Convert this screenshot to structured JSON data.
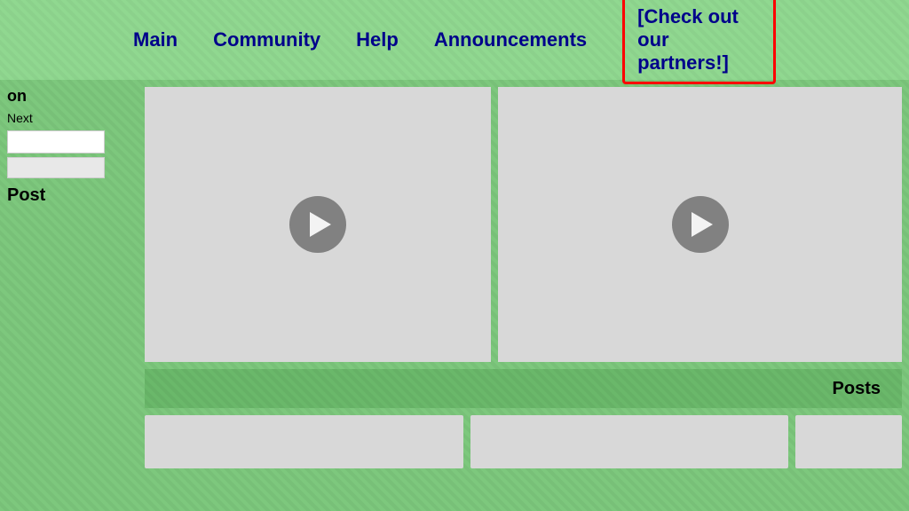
{
  "navbar": {
    "items": [
      {
        "id": "main",
        "label": "Main"
      },
      {
        "id": "community",
        "label": "Community"
      },
      {
        "id": "help",
        "label": "Help"
      },
      {
        "id": "announcements",
        "label": "Announcements"
      }
    ],
    "partners_label": "[Check out our partners!]"
  },
  "sidebar": {
    "on_label": "on",
    "next_label": "Next",
    "post_label": "Post"
  },
  "main": {
    "posts_label": "Posts"
  }
}
